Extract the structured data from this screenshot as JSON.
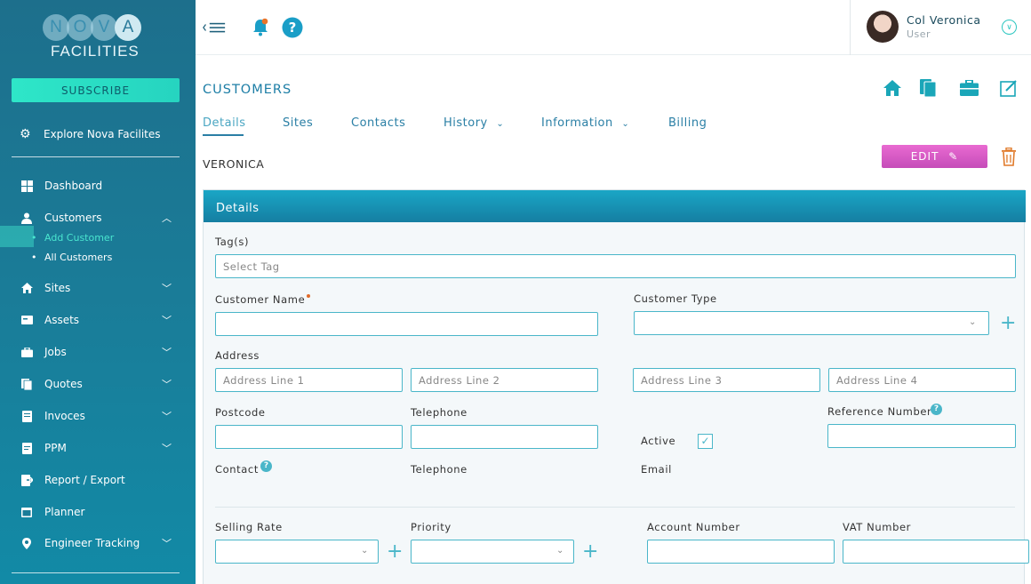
{
  "sidebar": {
    "logo_letters": [
      "N",
      "O",
      "V",
      "A"
    ],
    "logo_sub": "FACILITIES",
    "subscribe_label": "SUBSCRIBE",
    "explore_label": "Explore Nova Facilites",
    "items": [
      {
        "label": "Dashboard",
        "icon": "dashboard-icon"
      },
      {
        "label": "Customers",
        "icon": "user-icon"
      },
      {
        "label": "Sites",
        "icon": "home-icon"
      },
      {
        "label": "Assets",
        "icon": "assets-icon"
      },
      {
        "label": "Jobs",
        "icon": "briefcase-icon"
      },
      {
        "label": "Quotes",
        "icon": "quotes-icon"
      },
      {
        "label": "Invoces",
        "icon": "invoice-icon"
      },
      {
        "label": "PPM",
        "icon": "ppm-icon"
      },
      {
        "label": "Report / Export",
        "icon": "export-icon"
      },
      {
        "label": "Planner",
        "icon": "calendar-icon"
      },
      {
        "label": "Engineer Tracking",
        "icon": "location-pin-icon"
      }
    ],
    "customers_sub": [
      {
        "label": "Add Customer"
      },
      {
        "label": "All Customers"
      }
    ]
  },
  "user": {
    "name": "Col Veronica",
    "role": "User"
  },
  "page": {
    "title": "CUSTOMERS",
    "tabs": [
      {
        "label": "Details"
      },
      {
        "label": "Sites"
      },
      {
        "label": "Contacts"
      },
      {
        "label": "History"
      },
      {
        "label": "Information"
      },
      {
        "label": "Billing"
      }
    ],
    "customer_name": "VERONICA",
    "edit_label": "EDIT"
  },
  "form": {
    "panel_title": "Details",
    "tags_label": "Tag(s)",
    "tags_placeholder": "Select Tag",
    "customer_name_label": "Customer Name",
    "customer_type_label": "Customer Type",
    "address_label": "Address",
    "address_line1": "Address Line 1",
    "address_line2": "Address Line 2",
    "address_line3": "Address Line 3",
    "address_line4": "Address Line 4",
    "postcode_label": "Postcode",
    "telephone_label": "Telephone",
    "active_label": "Active",
    "reference_label": "Reference Number",
    "contact_label": "Contact",
    "telephone2_label": "Telephone",
    "email_label": "Email",
    "selling_rate_label": "Selling Rate",
    "priority_label": "Priority",
    "account_label": "Account Number",
    "vat_label": "VAT Number"
  },
  "colors": {
    "accent": "#2a7fa5",
    "teal": "#2ee6c8",
    "edit": "#d85ac6"
  }
}
